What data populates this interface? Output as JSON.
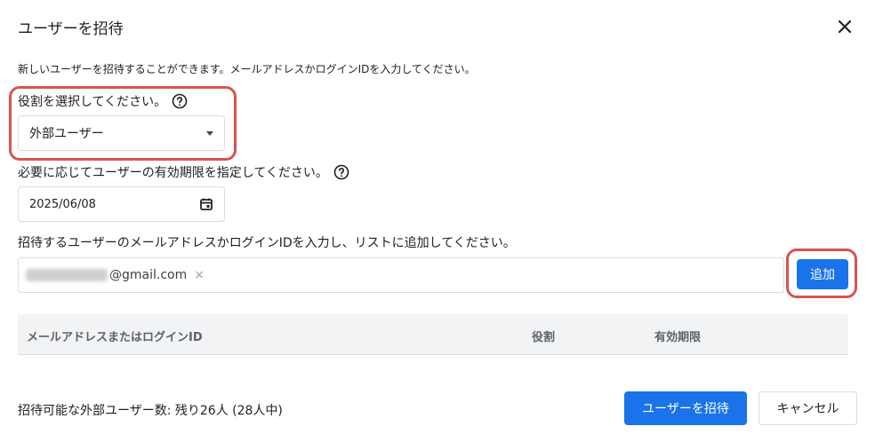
{
  "dialog": {
    "title": "ユーザーを招待",
    "description": "新しいユーザーを招待することができます。メールアドレスかログインIDを入力してください。"
  },
  "role": {
    "label": "役割を選択してください。",
    "selected": "外部ユーザー"
  },
  "expiry": {
    "label": "必要に応じてユーザーの有効期限を指定してください。",
    "value": "2025/06/08"
  },
  "email": {
    "label": "招待するユーザーのメールアドレスかログインIDを入力し、リストに追加してください。",
    "chip_domain": "@gmail.com",
    "chip_remove": "×",
    "add_label": "追加"
  },
  "table": {
    "headers": [
      "メールアドレスまたはログインID",
      "役割",
      "有効期限"
    ]
  },
  "footer": {
    "remaining": "招待可能な外部ユーザー数: 残り26人 (28人中)",
    "invite_label": "ユーザーを招待",
    "cancel_label": "キャンセル"
  },
  "icons": {
    "close": "close-icon",
    "help": "help-circle-icon",
    "calendar": "calendar-icon",
    "dropdown": "caret-down-icon"
  },
  "colors": {
    "primary": "#1a73e8",
    "highlight": "#d9534f"
  }
}
